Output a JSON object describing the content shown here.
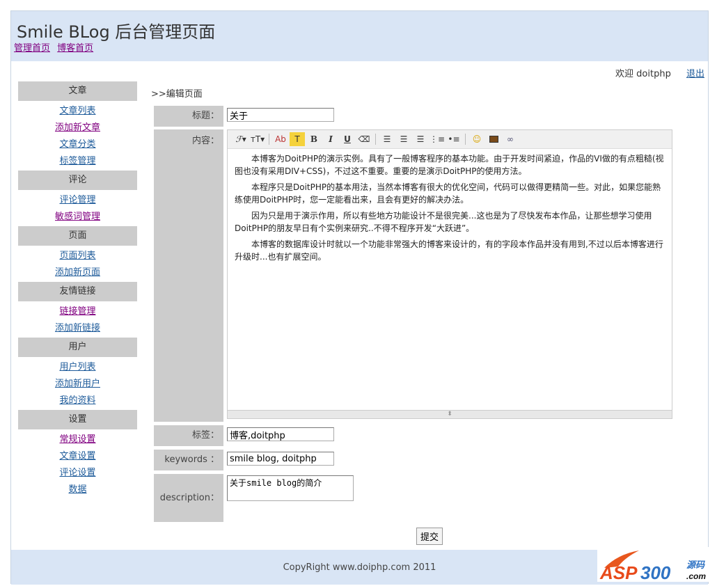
{
  "header": {
    "title": "Smile BLog 后台管理页面",
    "links": [
      "管理首页",
      "博客首页"
    ]
  },
  "welcome": {
    "text": "欢迎 doitphp",
    "logout": "退出"
  },
  "breadcrumb": ">>编辑页面",
  "sidebar": [
    {
      "title": "文章",
      "items": [
        "文章列表",
        "添加新文章",
        "文章分类",
        "标签管理"
      ]
    },
    {
      "title": "评论",
      "items": [
        "评论管理",
        "敏感词管理"
      ]
    },
    {
      "title": "页面",
      "items": [
        "页面列表",
        "添加新页面"
      ]
    },
    {
      "title": "友情链接",
      "items": [
        "链接管理",
        "添加新链接"
      ]
    },
    {
      "title": "用户",
      "items": [
        "用户列表",
        "添加新用户",
        "我的资料"
      ]
    },
    {
      "title": "设置",
      "items": [
        "常规设置",
        "文章设置",
        "评论设置",
        "数据"
      ]
    }
  ],
  "form": {
    "title_label": "标题：",
    "title_value": "关于",
    "content_label": "内容：",
    "content": [
      "本博客为DoitPHP的演示实例。具有了一般博客程序的基本功能。由于开发时间紧迫，作品的VI做的有点粗糙(视图也没有采用DIV+CSS)，不过这不重要。重要的是演示DoitPHP的使用方法。",
      "本程序只是DoitPHP的基本用法，当然本博客有很大的优化空间，代码可以做得更精简一些。对此，如果您能熟练使用DoitPHP时，您一定能看出来，且会有更好的解决办法。",
      "因为只是用于演示作用，所以有些地方功能设计不是很完美...这也是为了尽快发布本作品，让那些想学习使用DoitPHP的朋友早日有个实例来研究..不得不程序开发“大跃进”。",
      "本博客的数据库设计时就以一个功能非常强大的博客来设计的，有的字段本作品并没有用到,不过以后本博客进行升级时...也有扩展空间。"
    ],
    "tags_label": "标签：",
    "tags_value": "博客,doitphp",
    "keywords_label": "keywords ：",
    "keywords_value": "smile blog, doitphp",
    "description_label": "description：",
    "description_value": "关于smile blog的简介",
    "submit": "提交"
  },
  "toolbar": [
    "font-family",
    "font-size",
    "text-color",
    "highlight",
    "bold",
    "italic",
    "underline",
    "remove-format",
    "align-left",
    "align-center",
    "align-right",
    "ordered-list",
    "unordered-list",
    "emoticon",
    "image",
    "link"
  ],
  "footer": "CopyRight www.doiphp.com 2011",
  "watermark": "ASP300 源码 .com"
}
